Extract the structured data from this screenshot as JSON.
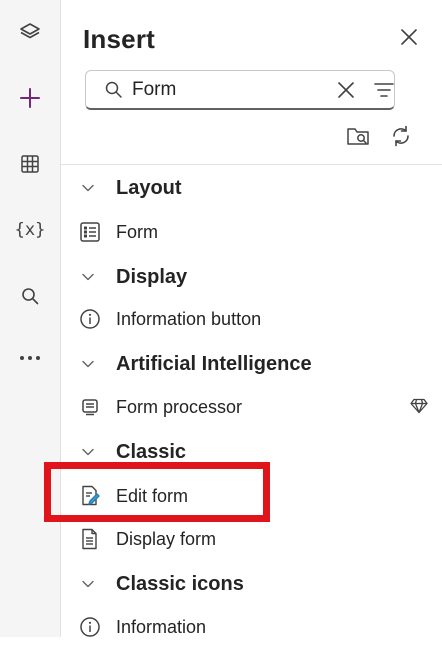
{
  "panel": {
    "title": "Insert",
    "search": {
      "value": "Form",
      "placeholder": "Search"
    }
  },
  "rail": {
    "icons": [
      "layers-icon",
      "add-icon",
      "table-icon",
      "variables-icon",
      "search-icon",
      "more-icon"
    ],
    "variables_text": "{x}",
    "more_text": "···"
  },
  "colors": {
    "accent": "#742774",
    "highlight": "#e0141b",
    "text": "#242424"
  },
  "sections": [
    {
      "category": "Layout",
      "items": [
        {
          "label": "Form",
          "icon": "form-icon"
        }
      ]
    },
    {
      "category": "Display",
      "items": [
        {
          "label": "Information button",
          "icon": "info-icon"
        }
      ]
    },
    {
      "category": "Artificial Intelligence",
      "items": [
        {
          "label": "Form processor",
          "icon": "form-processor-icon",
          "premium": true
        }
      ]
    },
    {
      "category": "Classic",
      "items": [
        {
          "label": "Edit form",
          "icon": "edit-form-icon"
        },
        {
          "label": "Display form",
          "icon": "display-form-icon"
        }
      ]
    },
    {
      "category": "Classic icons",
      "items": [
        {
          "label": "Information",
          "icon": "info-icon"
        }
      ]
    }
  ]
}
